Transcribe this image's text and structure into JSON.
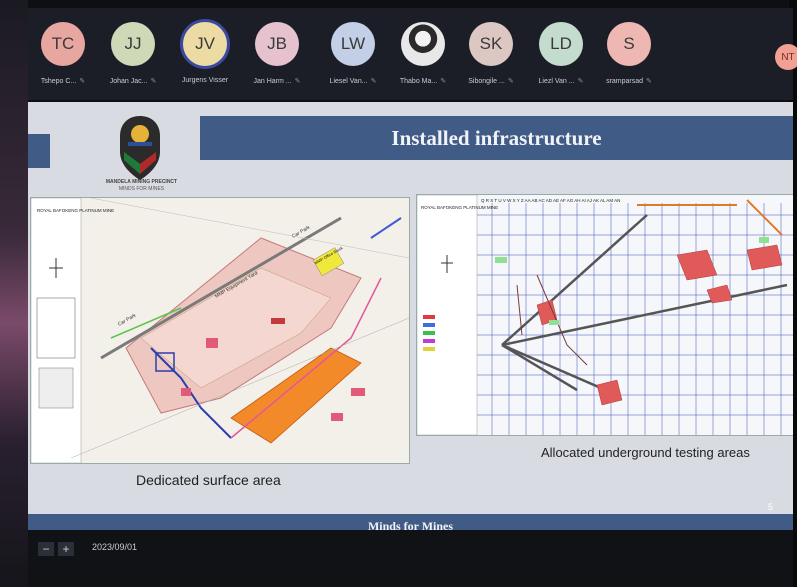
{
  "participants": [
    {
      "initials": "TC",
      "name": "Tshepo C...",
      "color": "#e8a6a0"
    },
    {
      "initials": "JJ",
      "name": "Johan Jac...",
      "color": "#cfd9b8"
    },
    {
      "initials": "JV",
      "name": "Jurgens Visser",
      "color": "#ecdca4"
    },
    {
      "initials": "JB",
      "name": "Jan Harm ...",
      "color": "#e6c2cf"
    },
    {
      "initials": "LW",
      "name": "Liesel Van...",
      "color": "#c3cfe6"
    },
    {
      "initials": "",
      "name": "Thabo Ma...",
      "color": "#cfcfcf"
    },
    {
      "initials": "SK",
      "name": "Sibongile ...",
      "color": "#dcc7c3"
    },
    {
      "initials": "LD",
      "name": "Liezl Van ...",
      "color": "#c4dccd"
    },
    {
      "initials": "S",
      "name": "sramparsad",
      "color": "#efb7b1"
    }
  ],
  "corner_avatar": "NT",
  "slide": {
    "title": "Installed infrastructure",
    "logo_title": "MANDELA MINING PRECINCT",
    "logo_subtitle": "MINDS FOR MINES",
    "caption_left": "Dedicated surface area",
    "caption_right": "Allocated underground testing areas",
    "footer": "Minds for Mines",
    "page_number": "5"
  },
  "map_left_labels": {
    "header": "ROYAL BAFOKENG PLATINUM MINE",
    "yard": "MMP Equipment Yard",
    "office": "MMP Office Block",
    "car_park_1": "Car Park",
    "car_park_2": "Car Park"
  },
  "map_right_labels": {
    "header": "ROYAL BAFOKENG PLATINUM MINE",
    "columns": "Q R S T U V W X Y Z AA AB AC AD AE AF AG AH AI AJ AK AL AM AN"
  },
  "bottom": {
    "zoom_out": "−",
    "zoom_in": "+",
    "date": "2023/09/01"
  },
  "colors": {
    "title_bar": "#3f5b86",
    "slide_bg": "#d8dbe2",
    "topbar": "#1b1e27"
  }
}
